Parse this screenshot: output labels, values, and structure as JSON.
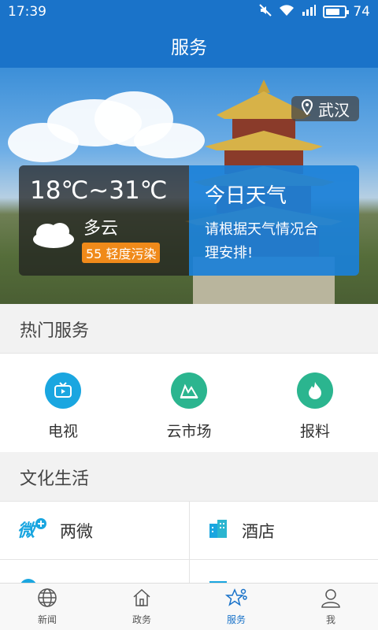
{
  "status": {
    "time": "17:39",
    "battery": "74",
    "battery_level": 0.74
  },
  "header": {
    "title": "服务"
  },
  "banner": {
    "location": "武汉",
    "weather": {
      "temperature": "18℃~31℃",
      "condition": "多云",
      "air_quality": "55 轻度污染"
    },
    "today": {
      "title": "今日天气",
      "line1": "请根据天气情况合",
      "line2": "理安排!"
    }
  },
  "hot_services": {
    "title": "热门服务",
    "items": [
      {
        "label": "电视",
        "icon": "tv-icon",
        "color": "#1aa6e0"
      },
      {
        "label": "云市场",
        "icon": "market-icon",
        "color": "#2bb58f"
      },
      {
        "label": "报料",
        "icon": "flame-icon",
        "color": "#2bb58f"
      }
    ]
  },
  "culture": {
    "title": "文化生活",
    "items": [
      {
        "label": "两微",
        "icon": "weibo-weixin-icon"
      },
      {
        "label": "酒店",
        "icon": "hotel-icon"
      }
    ]
  },
  "tabbar": {
    "items": [
      {
        "label": "新闻",
        "icon": "globe-icon"
      },
      {
        "label": "政务",
        "icon": "home-icon"
      },
      {
        "label": "服务",
        "icon": "star-service-icon",
        "active": true
      },
      {
        "label": "我",
        "icon": "user-icon"
      }
    ]
  }
}
